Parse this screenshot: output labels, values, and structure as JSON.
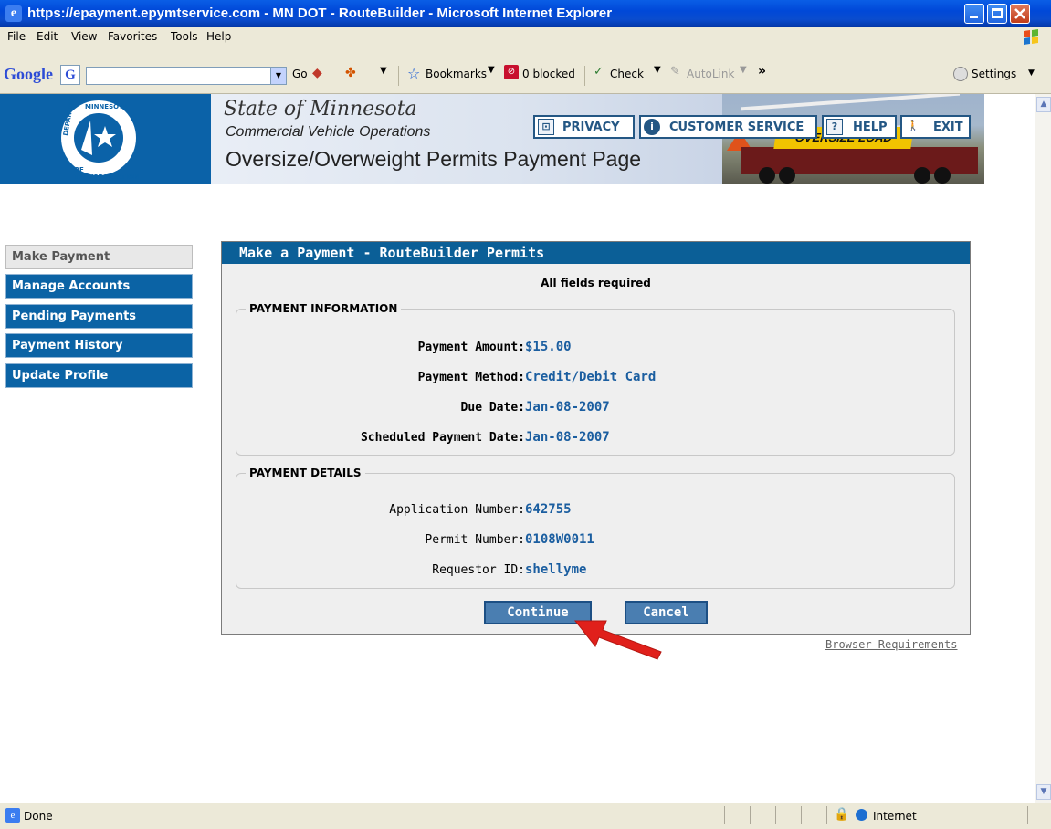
{
  "window": {
    "title": "https://epayment.epymtservice.com - MN DOT - RouteBuilder - Microsoft Internet Explorer"
  },
  "menu": [
    "File",
    "Edit",
    "View",
    "Favorites",
    "Tools",
    "Help"
  ],
  "google_toolbar": {
    "brand": "Google",
    "go": "Go",
    "bookmarks": "Bookmarks",
    "blocked": "0 blocked",
    "check": "Check",
    "autolink": "AutoLink",
    "settings": "Settings"
  },
  "banner": {
    "state": "State of Minnesota",
    "program": "Commercial Vehicle Operations",
    "page_title": "Oversize/Overweight Permits Payment Page",
    "sign_text": "OVERSIZE LOAD",
    "seal_top": "MINNESOTA",
    "seal_left": "DEPARTMENT",
    "seal_bottom": "OF TRANSPORTATION"
  },
  "topnav": {
    "privacy": "PRIVACY",
    "customer_service": "CUSTOMER SERVICE",
    "help": "HELP",
    "exit": "EXIT"
  },
  "sidebar": [
    {
      "label": "Make Payment",
      "active": true
    },
    {
      "label": "Manage Accounts",
      "active": false
    },
    {
      "label": "Pending Payments",
      "active": false
    },
    {
      "label": "Payment History",
      "active": false
    },
    {
      "label": "Update Profile",
      "active": false
    }
  ],
  "panel": {
    "title": "Make a Payment - RouteBuilder Permits",
    "required_note": "All fields required",
    "payment_info": {
      "legend": "PAYMENT INFORMATION",
      "rows": [
        {
          "label": "Payment Amount:",
          "value": "$15.00"
        },
        {
          "label": "Payment Method:",
          "value": "Credit/Debit Card"
        },
        {
          "label": "Due Date:",
          "value": "Jan-08-2007"
        },
        {
          "label": "Scheduled Payment Date:",
          "value": "Jan-08-2007"
        }
      ]
    },
    "payment_details": {
      "legend": "PAYMENT DETAILS",
      "rows": [
        {
          "label": "Application Number:",
          "value": "642755"
        },
        {
          "label": "Permit Number:",
          "value": "0108W0011"
        },
        {
          "label": "Requestor ID:",
          "value": "shellyme"
        }
      ]
    },
    "continue_label": "Continue",
    "cancel_label": "Cancel"
  },
  "browser_requirements": "Browser Requirements",
  "status": {
    "text": "Done",
    "zone": "Internet"
  },
  "colors": {
    "header_blue": "#0b5f97",
    "value_blue": "#1b5ea0",
    "annotation_red": "#e0201b"
  }
}
